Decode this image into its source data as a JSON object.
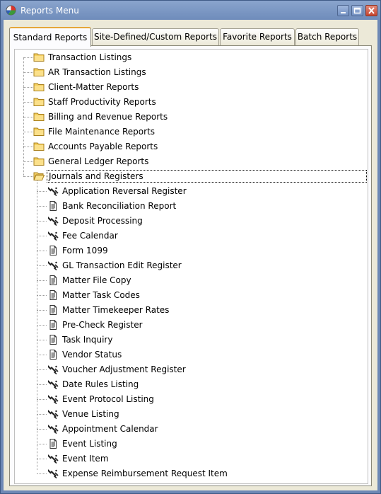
{
  "window": {
    "title": "Reports Menu"
  },
  "tabs": [
    {
      "label": "Standard Reports",
      "active": true
    },
    {
      "label": "Site-Defined/Custom Reports",
      "active": false
    },
    {
      "label": "Favorite Reports",
      "active": false
    },
    {
      "label": "Batch Reports",
      "active": false
    }
  ],
  "tree": {
    "folders": [
      "Transaction Listings",
      "AR Transaction Listings",
      "Client-Matter Reports",
      "Staff Productivity Reports",
      "Billing and Revenue Reports",
      "File Maintenance Reports",
      "Accounts Payable Reports",
      "General Ledger Reports",
      "Journals and Registers"
    ],
    "expanded_folder": "Journals and Registers",
    "reports": [
      {
        "label": "Application Reversal Register",
        "icon": "wizard-icon"
      },
      {
        "label": "Bank Reconciliation Report",
        "icon": "report-icon"
      },
      {
        "label": "Deposit Processing",
        "icon": "wizard-icon"
      },
      {
        "label": "Fee Calendar",
        "icon": "wizard-icon"
      },
      {
        "label": "Form 1099",
        "icon": "report-icon"
      },
      {
        "label": "GL Transaction Edit Register",
        "icon": "wizard-icon"
      },
      {
        "label": "Matter File Copy",
        "icon": "report-icon"
      },
      {
        "label": "Matter Task Codes",
        "icon": "report-icon"
      },
      {
        "label": "Matter Timekeeper Rates",
        "icon": "report-icon"
      },
      {
        "label": "Pre-Check Register",
        "icon": "report-icon"
      },
      {
        "label": "Task Inquiry",
        "icon": "report-icon"
      },
      {
        "label": "Vendor Status",
        "icon": "report-icon"
      },
      {
        "label": "Voucher Adjustment Register",
        "icon": "wizard-icon"
      },
      {
        "label": "Date Rules Listing",
        "icon": "wizard-icon"
      },
      {
        "label": "Event Protocol Listing",
        "icon": "wizard-icon"
      },
      {
        "label": "Venue Listing",
        "icon": "wizard-icon"
      },
      {
        "label": "Appointment Calendar",
        "icon": "wizard-icon"
      },
      {
        "label": "Event Listing",
        "icon": "report-icon"
      },
      {
        "label": "Event Item",
        "icon": "wizard-icon"
      },
      {
        "label": "Expense Reimbursement Request Item",
        "icon": "wizard-icon"
      }
    ]
  }
}
